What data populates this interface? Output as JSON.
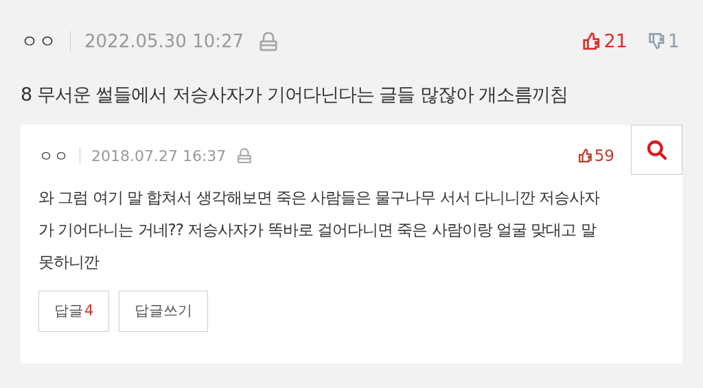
{
  "post": {
    "author": "ㅇㅇ",
    "date": "2022.05.30 10:27",
    "likes": "21",
    "dislikes": "1",
    "title": "8 무서운 썰들에서 저승사자가 기어다닌다는 글들 많잖아 개소름끼침"
  },
  "comment": {
    "author": "ㅇㅇ",
    "date": "2018.07.27 16:37",
    "likes": "59",
    "body": "와 그럼 여기 말 합쳐서 생각해보면 죽은 사람들은 물구나무 서서 다니니깐 저승사자가 기어다니는 거네?? 저승사자가 똑바로 걸어다니면 죽은 사람이랑 얼굴 맞대고 말 못하니깐",
    "buttons": [
      {
        "kind": "replies",
        "label": "답글",
        "count": "4"
      },
      {
        "kind": "write",
        "label": "답글쓰기"
      }
    ]
  }
}
